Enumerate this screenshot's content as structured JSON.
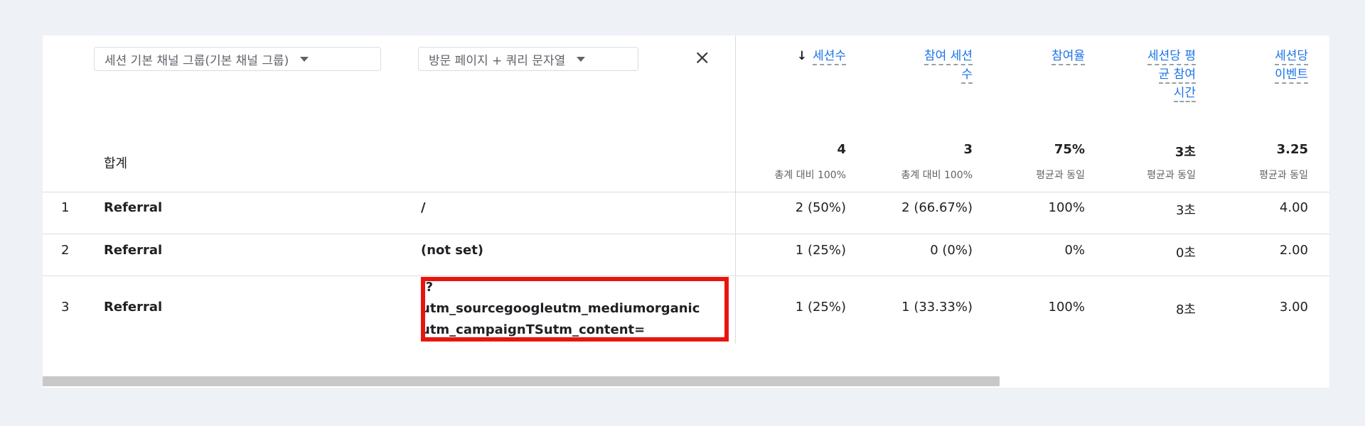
{
  "dimensions": {
    "primary": "세션 기본 채널 그룹(기본 채널 그룹)",
    "secondary": "방문 페이지 + 쿼리 문자열",
    "close": "×"
  },
  "metrics": [
    {
      "label_lines": [
        "세션수"
      ],
      "sorted": true,
      "sort_icon": "↓",
      "total": "4",
      "total_sub": "총계 대비 100%"
    },
    {
      "label_lines": [
        "참여 세션",
        "수"
      ],
      "total": "3",
      "total_sub": "총계 대비 100%"
    },
    {
      "label_lines": [
        "참여율"
      ],
      "total": "75%",
      "total_sub": "평균과 동일"
    },
    {
      "label_lines": [
        "세션당 평",
        "균 참여",
        "시간"
      ],
      "total": "3초",
      "total_sub": "평균과 동일"
    },
    {
      "label_lines": [
        "세션당",
        "이벤트"
      ],
      "total": "3.25",
      "total_sub": "평균과 동일"
    }
  ],
  "totals_label": "합계",
  "rows": [
    {
      "num": "1",
      "channel": "Referral",
      "page_lines": [
        "/"
      ],
      "values": [
        "2 (50%)",
        "2 (66.67%)",
        "100%",
        "3초",
        "4.00"
      ]
    },
    {
      "num": "2",
      "channel": "Referral",
      "page_lines": [
        "(not set)"
      ],
      "values": [
        "1 (25%)",
        "0 (0%)",
        "0%",
        "0초",
        "2.00"
      ]
    },
    {
      "num": "3",
      "channel": "Referral",
      "page_lines": [
        "/?",
        "utm_sourcegoogleutm_mediumorganic",
        "utm_campaignTSutm_content="
      ],
      "values": [
        "1 (25%)",
        "1 (33.33%)",
        "100%",
        "8초",
        "3.00"
      ]
    }
  ],
  "colors": {
    "highlight": "#e8150f",
    "link": "#1a73e8"
  }
}
